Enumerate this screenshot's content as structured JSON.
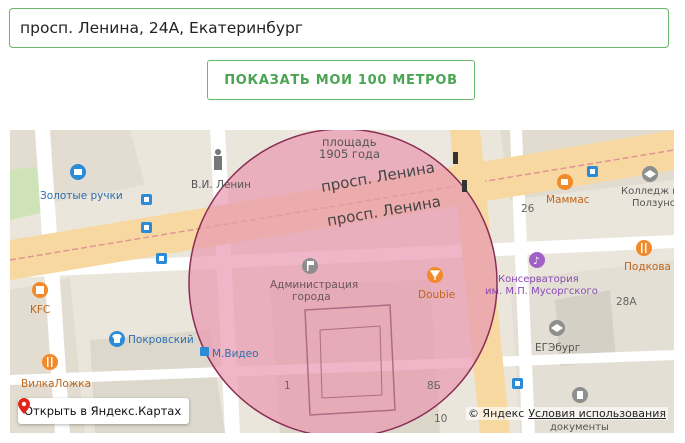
{
  "address_input": {
    "value": "просп. Ленина, 24А, Екатеринбург"
  },
  "show_button": {
    "label": "ПОКАЗАТЬ МОИ 100 МЕТРОВ"
  },
  "map": {
    "labels": {
      "square_1": "площадь",
      "square_2": "1905 года",
      "street_1": "просп. Ленина",
      "street_2": "просп. Ленина",
      "lenin": "В.И. Ленин",
      "golden_hands": "Золотые ручки",
      "administration_1": "Администрация",
      "administration_2": "города",
      "doubie": "Doubie",
      "conservatory_1": "Консерватория",
      "conservatory_2": "им. М.П. Мусоргского",
      "mammas": "Маммас",
      "college_1": "Колледж им",
      "college_2": "Ползунова",
      "podkova": "Подкова",
      "kfc": "KFC",
      "pokrovsky": "Покровский",
      "mvideo": "М.Видео",
      "vilkalozhka": "ВилкаЛожка",
      "egeburg": "ЕГЭбург",
      "num_26": "26",
      "num_28a": "28А",
      "num_1": "1",
      "num_8b": "8Б",
      "num_10": "10",
      "documents": "документы"
    },
    "open_button_label": "Открыть в Яндекс.Картах",
    "copyright": "© Яндекс",
    "terms_link": "Условия использования"
  },
  "colors": {
    "accent_green": "#4aa451",
    "radius_fill": "#e89ab0",
    "radius_stroke": "#8b2d55",
    "road_yellow": "#f8d8a1",
    "poi_green": "#3a9c3a",
    "poi_orange": "#f08a2a",
    "poi_blue": "#2c8bd8",
    "poi_purple": "#a060c8"
  }
}
